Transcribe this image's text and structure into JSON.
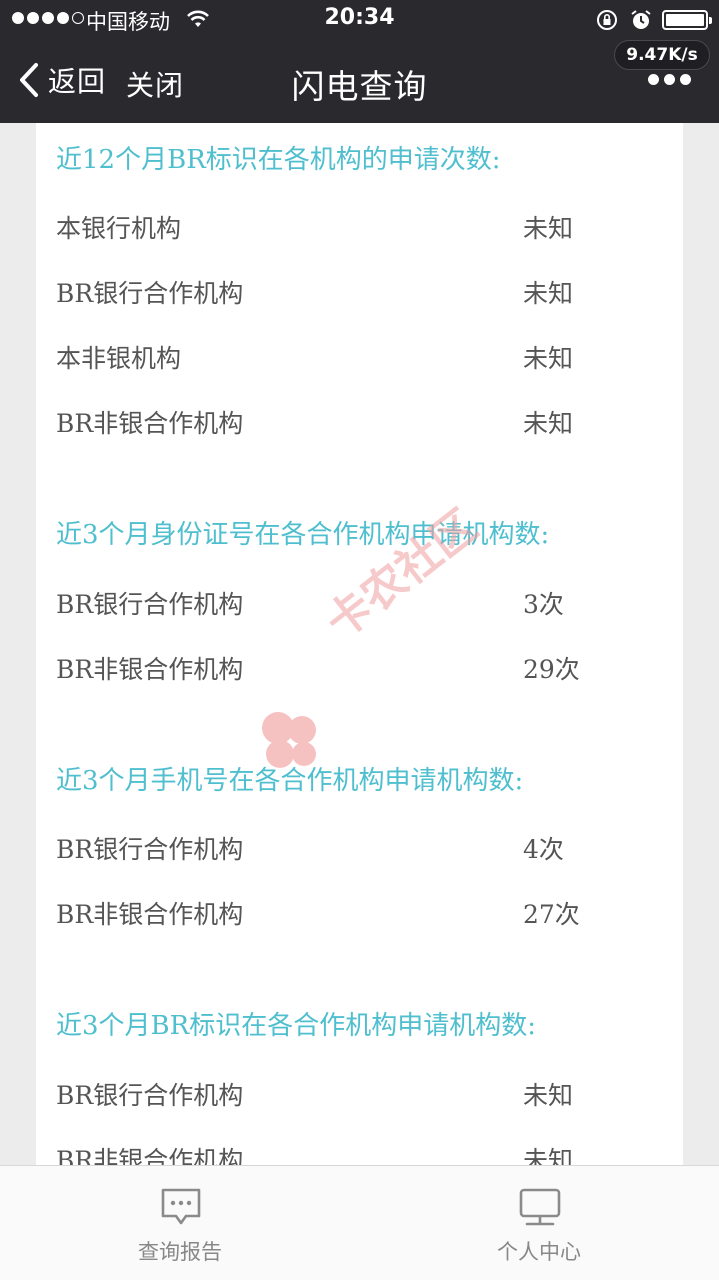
{
  "status_bar": {
    "carrier": "中国移动",
    "time": "20:34",
    "net_speed": "9.47K/s"
  },
  "nav": {
    "back_label": "返回",
    "close_label": "关闭",
    "title": "闪电查询"
  },
  "sections": [
    {
      "title": "近12个月BR标识在各机构的申请次数:",
      "rows": [
        {
          "label": "本银行机构",
          "value": "未知"
        },
        {
          "label": "BR银行合作机构",
          "value": "未知"
        },
        {
          "label": "本非银机构",
          "value": "未知"
        },
        {
          "label": "BR非银合作机构",
          "value": "未知"
        }
      ]
    },
    {
      "title": "近3个月身份证号在各合作机构申请机构数:",
      "rows": [
        {
          "label": "BR银行合作机构",
          "value": "3次"
        },
        {
          "label": "BR非银合作机构",
          "value": "29次"
        }
      ]
    },
    {
      "title": "近3个月手机号在各合作机构申请机构数:",
      "rows": [
        {
          "label": "BR银行合作机构",
          "value": "4次"
        },
        {
          "label": "BR非银合作机构",
          "value": "27次"
        }
      ]
    },
    {
      "title": "近3个月BR标识在各合作机构申请机构数:",
      "rows": [
        {
          "label": "BR银行合作机构",
          "value": "未知"
        },
        {
          "label": "BR非银合作机构",
          "value": "未知"
        }
      ]
    }
  ],
  "watermark": {
    "text": "卡农社区"
  },
  "tabs": [
    {
      "label": "查询报告",
      "icon": "chat-report-icon"
    },
    {
      "label": "个人中心",
      "icon": "monitor-icon"
    }
  ],
  "colors": {
    "nav_bg": "#2a292e",
    "section_title": "#4fbfcf",
    "row_text": "#555555",
    "tab_text": "#888888"
  }
}
